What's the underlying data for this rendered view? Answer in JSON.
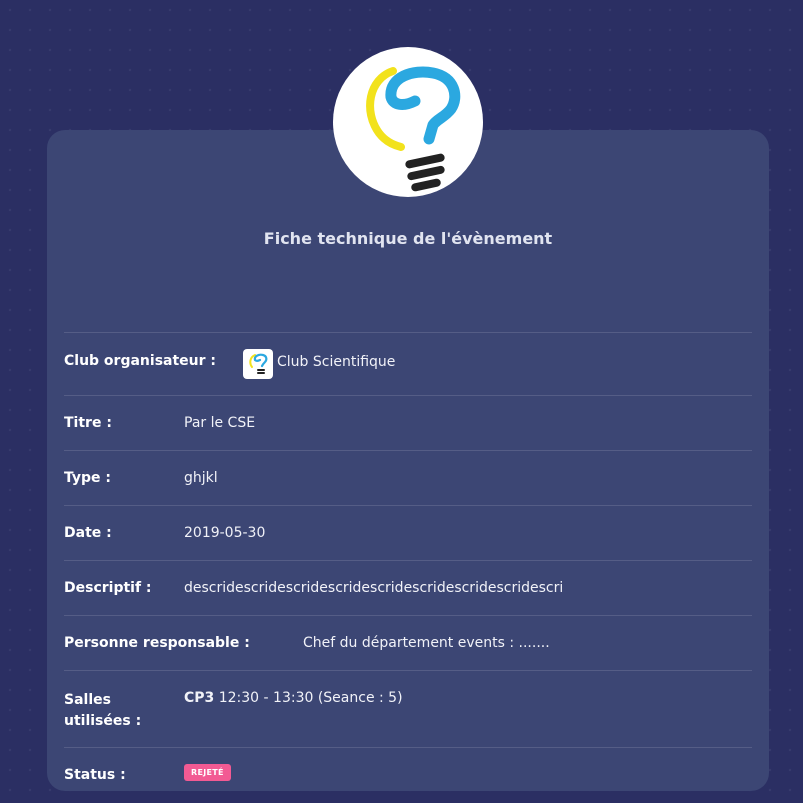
{
  "card": {
    "title": "Fiche technique de l'évènement"
  },
  "fields": {
    "club": {
      "label": "Club organisateur :",
      "value": "Club Scientifique",
      "icon": "club-logo-icon"
    },
    "titre": {
      "label": "Titre :",
      "value": "Par le CSE"
    },
    "type": {
      "label": "Type :",
      "value": "ghjkl"
    },
    "date": {
      "label": "Date :",
      "value": "2019-05-30"
    },
    "descriptif": {
      "label": "Descriptif :",
      "value": "descridescridescridescridescridescridescridescridescri"
    },
    "responsable": {
      "label": "Personne responsable :",
      "value": "Chef du département events : ......."
    },
    "salles": {
      "label_line1": "Salles",
      "label_line2": "utilisées :",
      "room": "CP3",
      "details": "12:30 - 13:30 (Seance : 5)"
    },
    "status": {
      "label": "Status :",
      "value": "REJETÉ",
      "color": "#f25a93"
    }
  },
  "colors": {
    "background": "#2b2f63",
    "card": "#3c4674",
    "logo_blue": "#2ba8e0",
    "logo_yellow": "#f2e21c"
  }
}
